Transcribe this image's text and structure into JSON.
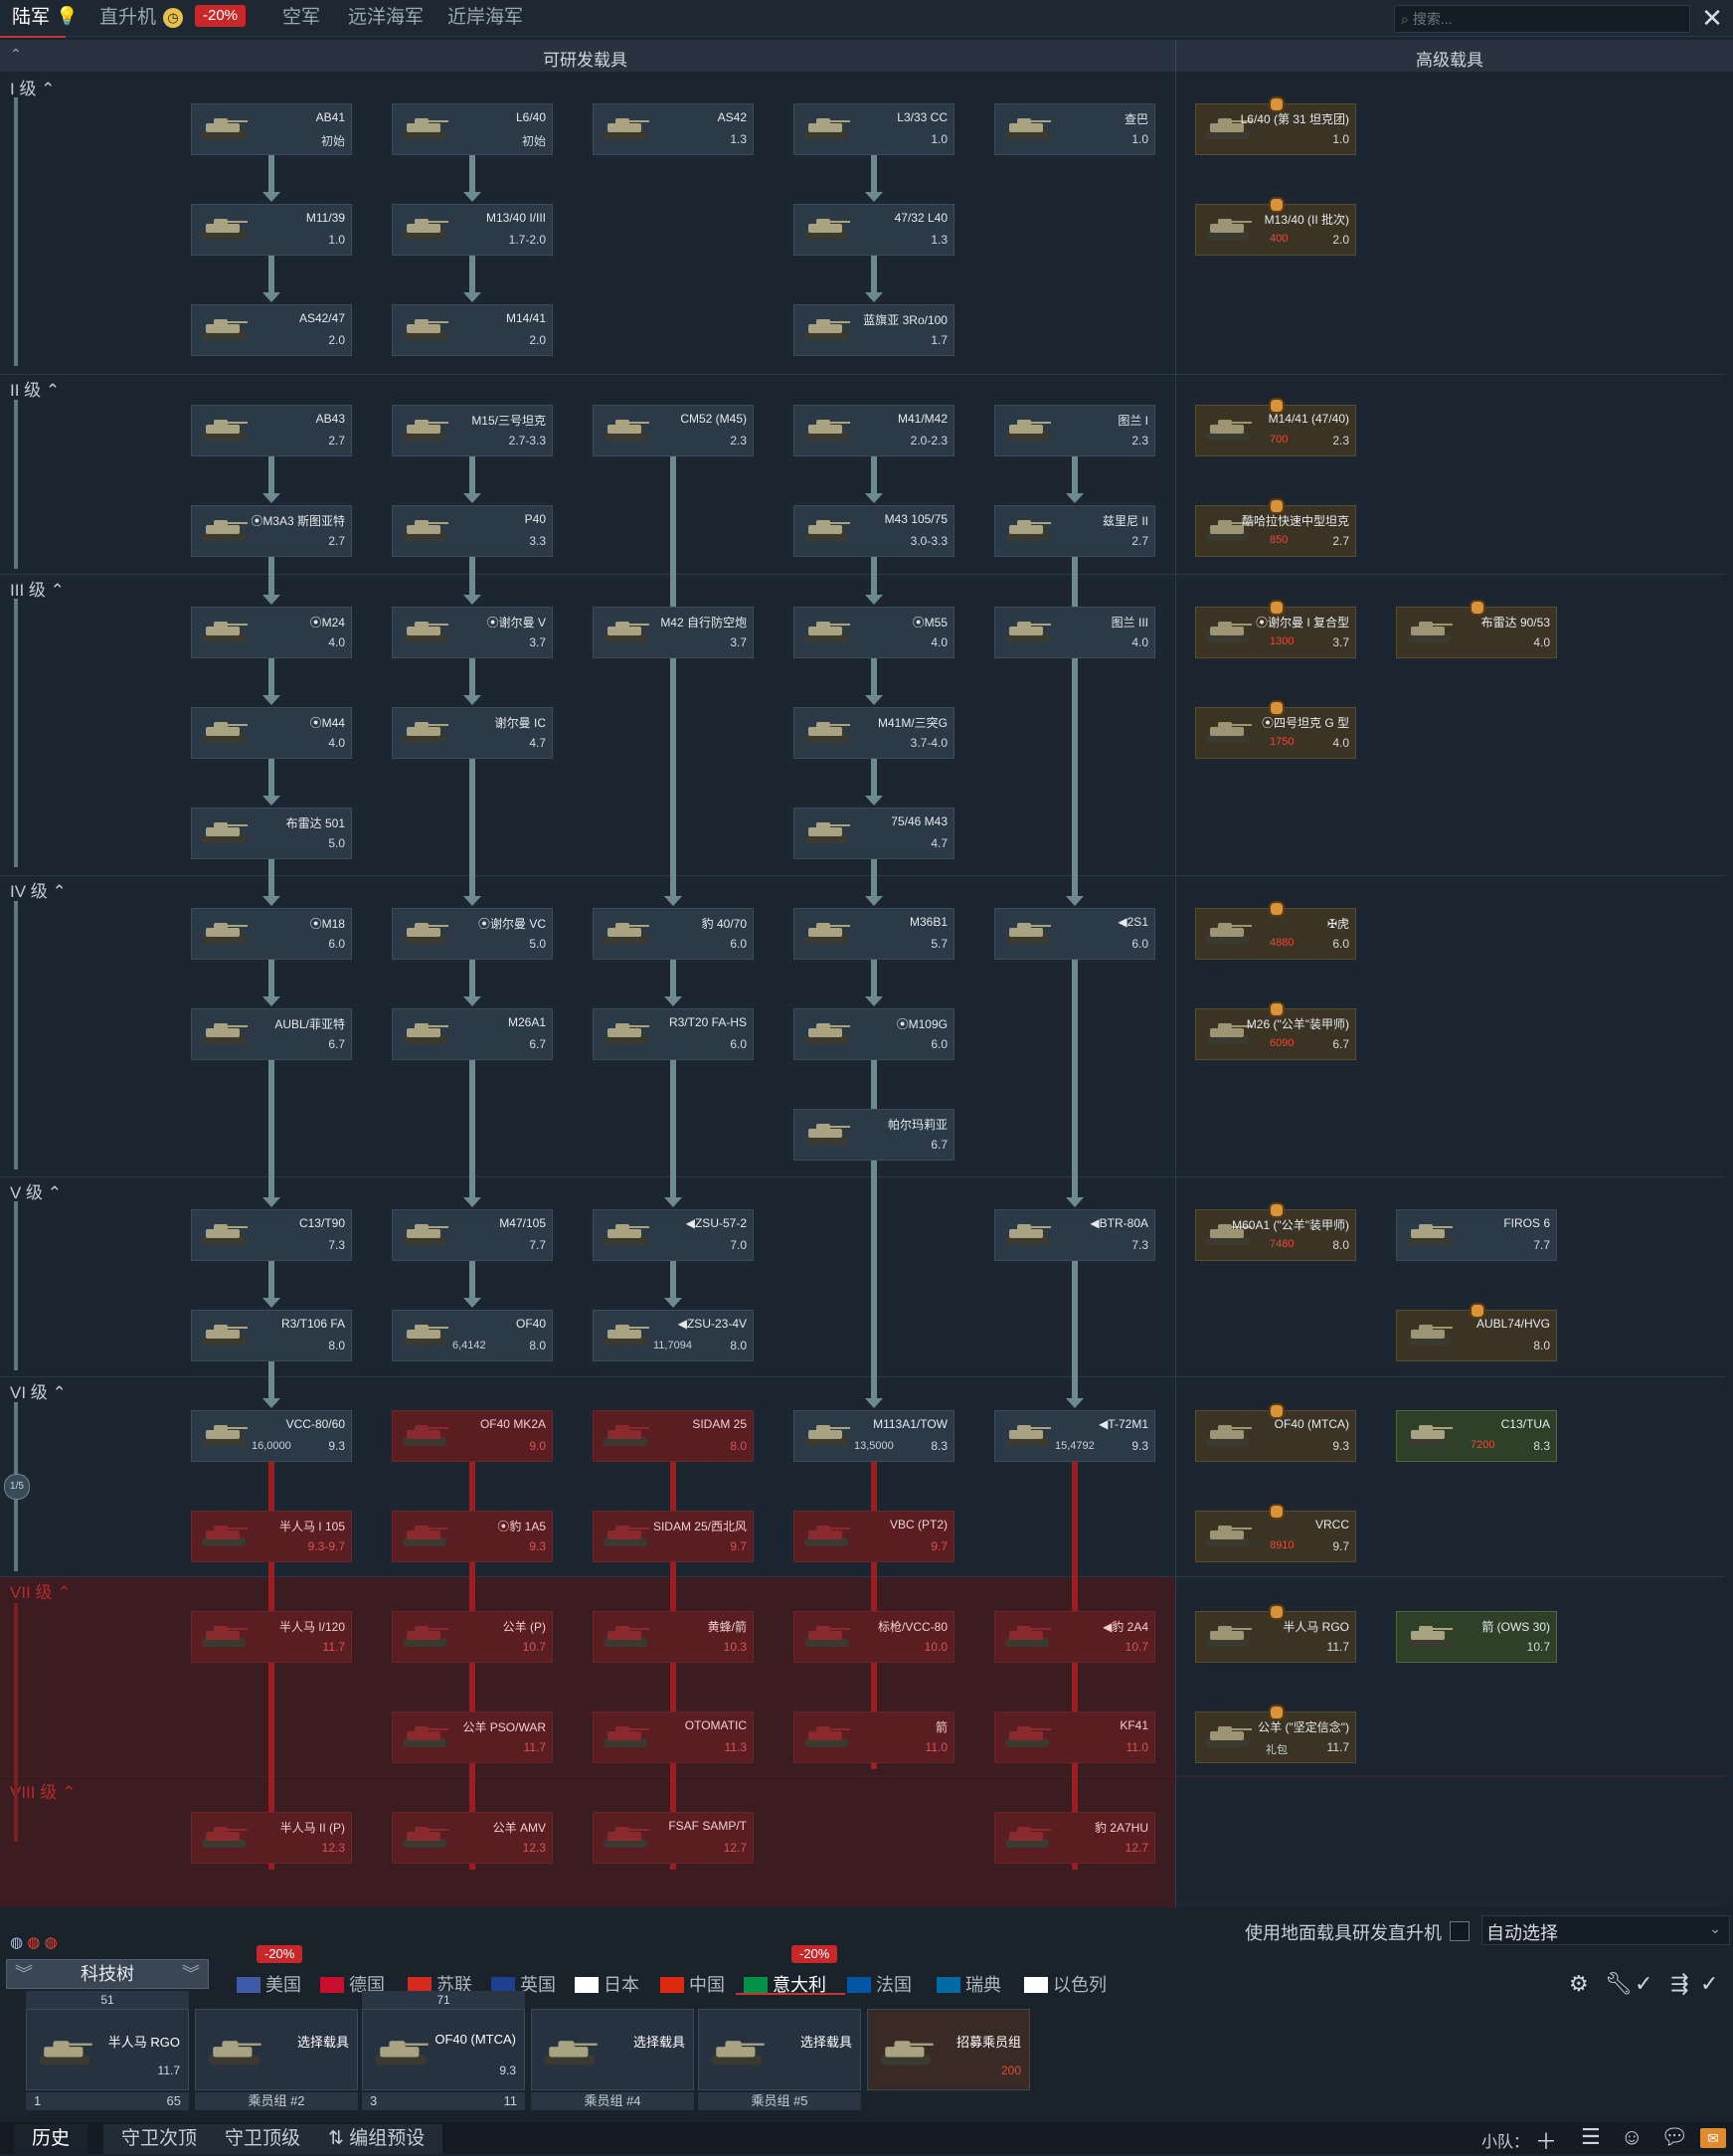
{
  "top_tabs": {
    "ground": "陆军",
    "heli": "直升机",
    "heli_discount": "-20%",
    "air": "空军",
    "bluewater": "远洋海军",
    "coastal": "近岸海军"
  },
  "search": {
    "placeholder": "搜索..."
  },
  "headers": {
    "researchable": "可研发载具",
    "premium": "高级载具"
  },
  "ranks": [
    "I 级",
    "II 级",
    "III 级",
    "IV 级",
    "V 级",
    "VI 级",
    "VII 级",
    "VIII 级"
  ],
  "vehicles": [
    {
      "name": "AB41",
      "br": "初始"
    },
    {
      "name": "L6/40",
      "br": "初始"
    },
    {
      "name": "AS42",
      "br": "1.3"
    },
    {
      "name": "L3/33 CC",
      "br": "1.0"
    },
    {
      "name": "查巴",
      "br": "1.0"
    },
    {
      "name": "L6/40 (第 31 坦克团)",
      "br": "1.0"
    },
    {
      "name": "M11/39",
      "br": "1.0"
    },
    {
      "name": "M13/40 I/III",
      "br": "1.7-2.0"
    },
    {
      "name": "47/32 L40",
      "br": "1.3"
    },
    {
      "name": "M13/40 (II 批次)",
      "br": "2.0",
      "cost": "400"
    },
    {
      "name": "AS42/47",
      "br": "2.0"
    },
    {
      "name": "M14/41",
      "br": "2.0"
    },
    {
      "name": "蓝旗亚 3Ro/100",
      "br": "1.7"
    },
    {
      "name": "AB43",
      "br": "2.7"
    },
    {
      "name": "M15/三号坦克",
      "br": "2.7-3.3"
    },
    {
      "name": "CM52 (M45)",
      "br": "2.3"
    },
    {
      "name": "M41/M42",
      "br": "2.0-2.3"
    },
    {
      "name": "图兰 I",
      "br": "2.3"
    },
    {
      "name": "M14/41 (47/40)",
      "br": "2.3",
      "cost": "700"
    },
    {
      "name": "⦿M3A3 斯图亚特",
      "br": "2.7"
    },
    {
      "name": "P40",
      "br": "3.3"
    },
    {
      "name": "M43 105/75",
      "br": "3.0-3.3"
    },
    {
      "name": "兹里尼 II",
      "br": "2.7"
    },
    {
      "name": "酷哈拉快速中型坦克",
      "br": "2.7",
      "cost": "850"
    },
    {
      "name": "⦿M24",
      "br": "4.0"
    },
    {
      "name": "⦿谢尔曼 V",
      "br": "3.7"
    },
    {
      "name": "M42 自行防空炮",
      "br": "3.7"
    },
    {
      "name": "⦿M55",
      "br": "4.0"
    },
    {
      "name": "图兰 III",
      "br": "4.0"
    },
    {
      "name": "⦿谢尔曼 I 复合型",
      "br": "3.7",
      "cost": "1300"
    },
    {
      "name": "布雷达 90/53",
      "br": "4.0"
    },
    {
      "name": "⦿M44",
      "br": "4.0"
    },
    {
      "name": "谢尔曼 IC",
      "br": "4.7"
    },
    {
      "name": "M41M/三突G",
      "br": "3.7-4.0"
    },
    {
      "name": "⦿四号坦克 G 型",
      "br": "4.0",
      "cost": "1750"
    },
    {
      "name": "布雷达 501",
      "br": "5.0"
    },
    {
      "name": "75/46 M43",
      "br": "4.7"
    },
    {
      "name": "⦿M18",
      "br": "6.0"
    },
    {
      "name": "⦿谢尔曼 VC",
      "br": "5.0"
    },
    {
      "name": "豹 40/70",
      "br": "6.0"
    },
    {
      "name": "M36B1",
      "br": "5.7"
    },
    {
      "name": "◀2S1",
      "br": "6.0"
    },
    {
      "name": "✠虎",
      "br": "6.0",
      "cost": "4880"
    },
    {
      "name": "AUBL/菲亚特",
      "br": "6.7"
    },
    {
      "name": "M26A1",
      "br": "6.7"
    },
    {
      "name": "R3/T20 FA-HS",
      "br": "6.0"
    },
    {
      "name": "⦿M109G",
      "br": "6.0"
    },
    {
      "name": "M26 (\"公羊\"装甲师)",
      "br": "6.7",
      "cost": "6090"
    },
    {
      "name": "帕尔玛莉亚",
      "br": "6.7"
    },
    {
      "name": "C13/T90",
      "br": "7.3"
    },
    {
      "name": "M47/105",
      "br": "7.7"
    },
    {
      "name": "◀ZSU-57-2",
      "br": "7.0"
    },
    {
      "name": "◀BTR-80A",
      "br": "7.3"
    },
    {
      "name": "M60A1 (\"公羊\"装甲师)",
      "br": "8.0",
      "cost": "7480"
    },
    {
      "name": "FIROS 6",
      "br": "7.7"
    },
    {
      "name": "R3/T106 FA",
      "br": "8.0"
    },
    {
      "name": "OF40",
      "br": "8.0",
      "rp": "6,4142"
    },
    {
      "name": "◀ZSU-23-4V",
      "br": "8.0",
      "rp": "11,7094"
    },
    {
      "name": "AUBL74/HVG",
      "br": "8.0"
    },
    {
      "name": "VCC-80/60",
      "br": "9.3",
      "rp": "16,0000"
    },
    {
      "name": "OF40 MK2A",
      "br": "9.0"
    },
    {
      "name": "SIDAM 25",
      "br": "8.0"
    },
    {
      "name": "M113A1/TOW",
      "br": "8.3",
      "rp": "13,5000"
    },
    {
      "name": "◀T-72M1",
      "br": "9.3",
      "rp": "15,4792"
    },
    {
      "name": "OF40 (MTCA)",
      "br": "9.3"
    },
    {
      "name": "C13/TUA",
      "br": "8.3",
      "cost": "7200"
    },
    {
      "name": "半人马 I 105",
      "br": "9.3-9.7"
    },
    {
      "name": "⦿豹 1A5",
      "br": "9.3"
    },
    {
      "name": "SIDAM 25/西北风",
      "br": "9.7"
    },
    {
      "name": "VBC (PT2)",
      "br": "9.7"
    },
    {
      "name": "VRCC",
      "br": "9.7",
      "cost": "8910"
    },
    {
      "name": "半人马 I/120",
      "br": "11.7"
    },
    {
      "name": "公羊 (P)",
      "br": "10.7"
    },
    {
      "name": "黄蜂/箭",
      "br": "10.3"
    },
    {
      "name": "标枪/VCC-80",
      "br": "10.0"
    },
    {
      "name": "◀豹 2A4",
      "br": "10.7"
    },
    {
      "name": "半人马 RGO",
      "br": "11.7"
    },
    {
      "name": "箭 (OWS 30)",
      "br": "10.7"
    },
    {
      "name": "公羊 PSO/WAR",
      "br": "11.7"
    },
    {
      "name": "OTOMATIC",
      "br": "11.3"
    },
    {
      "name": "箭",
      "br": "11.0"
    },
    {
      "name": "KF41",
      "br": "11.0"
    },
    {
      "name": "公羊 (\"坚定信念\")",
      "br": "11.7",
      "pack": "礼包"
    },
    {
      "name": "半人马 II (P)",
      "br": "12.3"
    },
    {
      "name": "公羊 AMV",
      "br": "12.3"
    },
    {
      "name": "FSAF SAMP/T",
      "br": "12.7"
    },
    {
      "name": "豹 2A7HU",
      "br": "12.7"
    }
  ],
  "page_indicator": "1/5",
  "bottom": {
    "heli_toggle_label": "使用地面载具研发直升机",
    "auto_select": "自动选择",
    "tech_tree_btn": "科技树",
    "nations": [
      "美国",
      "德国",
      "苏联",
      "英国",
      "日本",
      "中国",
      "意大利",
      "法国",
      "瑞典",
      "以色列"
    ],
    "nation_discount_a": "-20%",
    "nation_discount_b": "-20%",
    "slots": [
      {
        "vehicle": "半人马 RGO",
        "br": "11.7",
        "top": "51",
        "crew_num": "1",
        "crew_val": "65",
        "label": ""
      },
      {
        "vehicle": "选择载具",
        "br": "",
        "top": "",
        "crew_num": "",
        "crew_val": "",
        "label": "乘员组 #2"
      },
      {
        "vehicle": "OF40 (MTCA)",
        "br": "9.3",
        "top": "71",
        "crew_num": "3",
        "crew_val": "11",
        "label": ""
      },
      {
        "vehicle": "选择载具",
        "br": "",
        "top": "",
        "crew_num": "",
        "crew_val": "",
        "label": "乘员组 #4"
      },
      {
        "vehicle": "选择载具",
        "br": "",
        "top": "",
        "crew_num": "",
        "crew_val": "",
        "label": "乘员组 #5"
      },
      {
        "vehicle": "招募乘员组",
        "br": "200",
        "top": "",
        "crew_num": "",
        "crew_val": "",
        "label": ""
      }
    ],
    "tabs": [
      "历史",
      "守卫次顶",
      "守卫顶级",
      "编组预设"
    ],
    "squad_label": "小队："
  }
}
